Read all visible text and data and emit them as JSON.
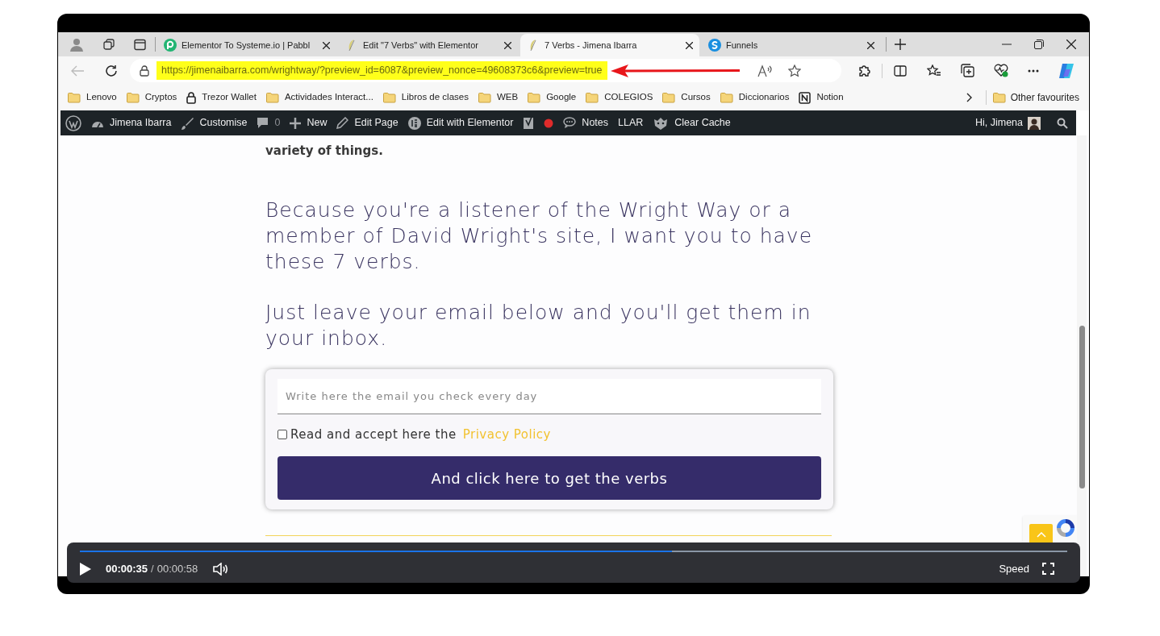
{
  "browser": {
    "tabs": [
      {
        "title": "Elementor To Systeme.io | Pabbl",
        "selected": false
      },
      {
        "title": "Edit \"7 Verbs\" with Elementor",
        "selected": false
      },
      {
        "title": "7 Verbs - Jimena Ibarra",
        "selected": true
      },
      {
        "title": "Funnels",
        "selected": false
      }
    ],
    "url": "https://jimenaibarra.com/wrightway/?preview_id=6087&preview_nonce=49608373c6&preview=true",
    "url_highlighted": true,
    "bookmarks": [
      {
        "label": "Lenovo",
        "kind": "folder"
      },
      {
        "label": "Cryptos",
        "kind": "folder"
      },
      {
        "label": "Trezor Wallet",
        "kind": "lock"
      },
      {
        "label": "Actividades Interact...",
        "kind": "folder"
      },
      {
        "label": "Libros de clases",
        "kind": "folder"
      },
      {
        "label": "WEB",
        "kind": "folder"
      },
      {
        "label": "Google",
        "kind": "folder"
      },
      {
        "label": "COLEGIOS",
        "kind": "folder"
      },
      {
        "label": "Cursos",
        "kind": "folder"
      },
      {
        "label": "Diccionarios",
        "kind": "folder"
      },
      {
        "label": "Notion",
        "kind": "notion"
      }
    ],
    "other_favourites": "Other favourites"
  },
  "admin_bar": {
    "items": [
      {
        "kind": "wordpress"
      },
      {
        "kind": "dashboard",
        "label": "Jimena Ibarra"
      },
      {
        "kind": "brush",
        "label": "Customise"
      },
      {
        "kind": "comment",
        "label": "0"
      },
      {
        "kind": "plus",
        "label": "New"
      },
      {
        "kind": "pencil",
        "label": "Edit Page"
      },
      {
        "kind": "elementor",
        "label": "Edit with Elementor"
      },
      {
        "kind": "seo"
      },
      {
        "kind": "dot"
      },
      {
        "kind": "notes",
        "label": "Notes"
      },
      {
        "kind": "text",
        "label": "LLAR"
      },
      {
        "kind": "cache",
        "label": "Clear Cache"
      }
    ],
    "greeting": "Hi, Jimena"
  },
  "page": {
    "intro_tail": "variety of things.",
    "headings": [
      "Because you're a listener of the Wright Way or a member of David Wright's site, I want you to have these 7 verbs.",
      "Just leave your email below and you'll get them in your inbox."
    ],
    "form": {
      "placeholder": "Write here the email you check every day",
      "consent": "Read and accept here the",
      "consent_link": "Privacy Policy",
      "checked": false,
      "button": "And click here to get the verbs"
    }
  },
  "player": {
    "playing": false,
    "level": 0.6,
    "current": "00:00:35",
    "separator": "/",
    "duration": "00:00:58",
    "speed": "Speed"
  }
}
